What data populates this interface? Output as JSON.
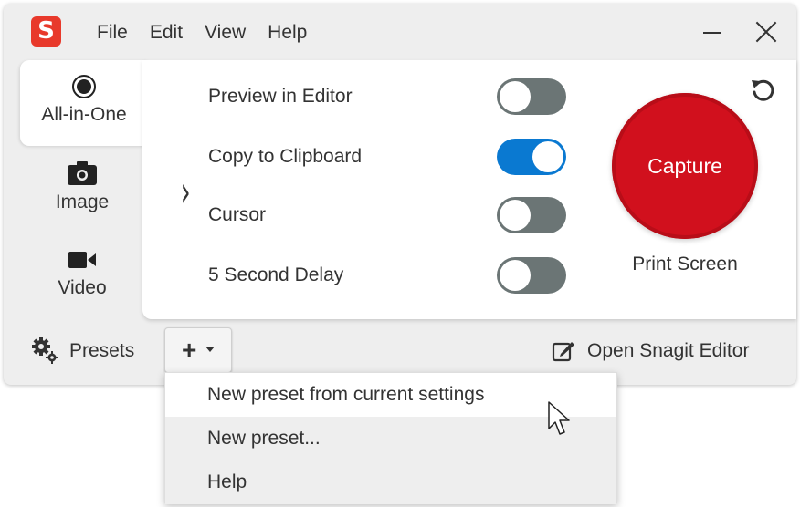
{
  "app": {
    "logo_letter": "S",
    "brand_color": "#e8392b"
  },
  "menu": {
    "file": "File",
    "edit": "Edit",
    "view": "View",
    "help": "Help"
  },
  "modes": [
    {
      "label": "All-in-One",
      "icon": "record-icon",
      "active": true
    },
    {
      "label": "Image",
      "icon": "camera-icon",
      "active": false
    },
    {
      "label": "Video",
      "icon": "video-camera-icon",
      "active": false
    }
  ],
  "options": [
    {
      "label": "Preview in Editor",
      "enabled": false
    },
    {
      "label": "Copy to Clipboard",
      "enabled": true
    },
    {
      "label": "Cursor",
      "enabled": false
    },
    {
      "label": "5 Second Delay",
      "enabled": false
    }
  ],
  "capture": {
    "button_label": "Capture",
    "hotkey": "Print Screen",
    "color": "#d1101d"
  },
  "toggle_colors": {
    "on": "#0a79d1",
    "off": "#6b7575"
  },
  "bottom": {
    "presets_label": "Presets",
    "add_symbol": "+",
    "open_editor_label": "Open Snagit Editor"
  },
  "dropdown": {
    "items": [
      {
        "label": "New preset from current settings"
      },
      {
        "label": "New preset..."
      },
      {
        "label": "Help"
      }
    ]
  }
}
